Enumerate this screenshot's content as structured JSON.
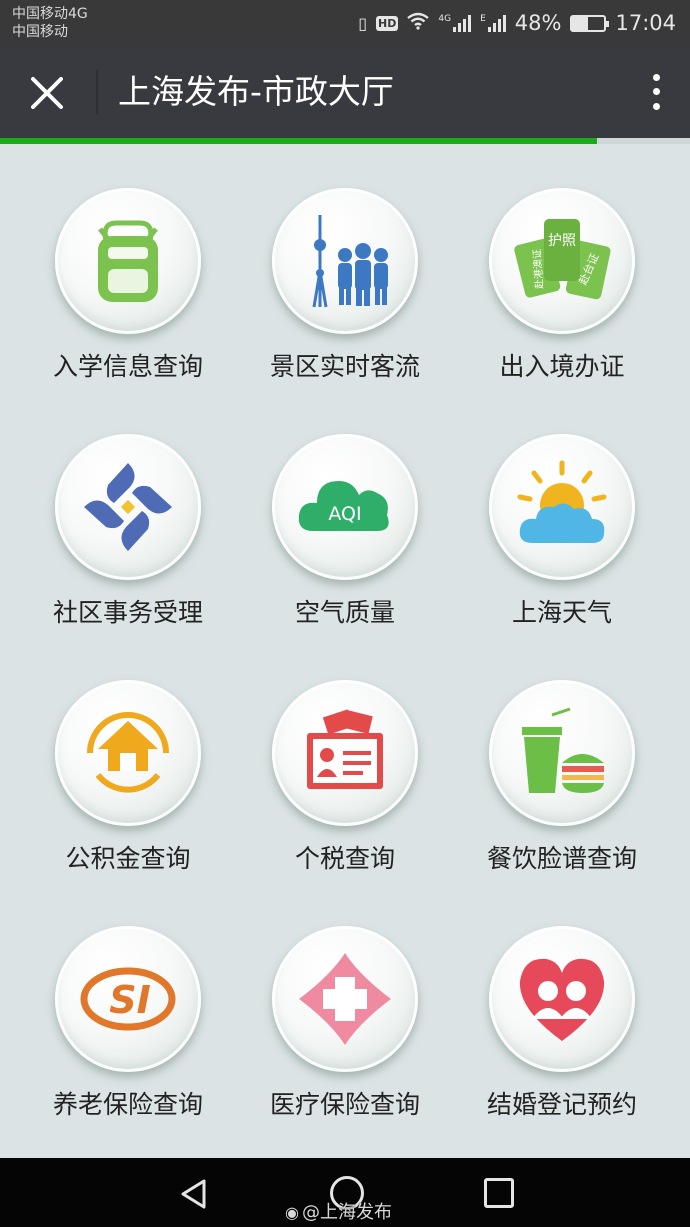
{
  "status_bar": {
    "carrier_line1": "中国移动4G",
    "carrier_line2": "中国移动",
    "net_4g": "4G",
    "net_e": "E",
    "hd": "HD",
    "battery_text": "48%",
    "battery_level": 0.48,
    "time": "17:04"
  },
  "titlebar": {
    "close_glyph": "✕",
    "title": "上海发布-市政大厅"
  },
  "progress": {
    "value": 0.865,
    "color": "#1aad19"
  },
  "services": [
    {
      "label": "入学信息查询",
      "icon": "backpack-icon"
    },
    {
      "label": "景区实时客流",
      "icon": "tower-crowd-icon"
    },
    {
      "label": "出入境办证",
      "icon": "passport-cards-icon"
    },
    {
      "label": "社区事务受理",
      "icon": "community-knot-icon"
    },
    {
      "label": "空气质量",
      "icon": "aqi-cloud-icon"
    },
    {
      "label": "上海天气",
      "icon": "sun-cloud-icon"
    },
    {
      "label": "公积金查询",
      "icon": "house-fund-icon"
    },
    {
      "label": "个税查询",
      "icon": "tax-card-icon"
    },
    {
      "label": "餐饮脸谱查询",
      "icon": "drink-burger-icon"
    },
    {
      "label": "养老保险查询",
      "icon": "social-insurance-icon"
    },
    {
      "label": "医疗保险查询",
      "icon": "medical-cross-icon"
    },
    {
      "label": "结婚登记预约",
      "icon": "couple-heart-icon"
    }
  ],
  "icon_text": {
    "aqi": "AQI",
    "card_left": "赴港澳证",
    "card_mid": "护照",
    "card_right": "赴台证",
    "si": "SI"
  },
  "watermark": {
    "handle": "@上海发布"
  },
  "colors": {
    "status_bar": "#393939",
    "title_bar": "#393a3f",
    "page_bg": "#dbe3e4",
    "accent_green": "#1aad19"
  }
}
